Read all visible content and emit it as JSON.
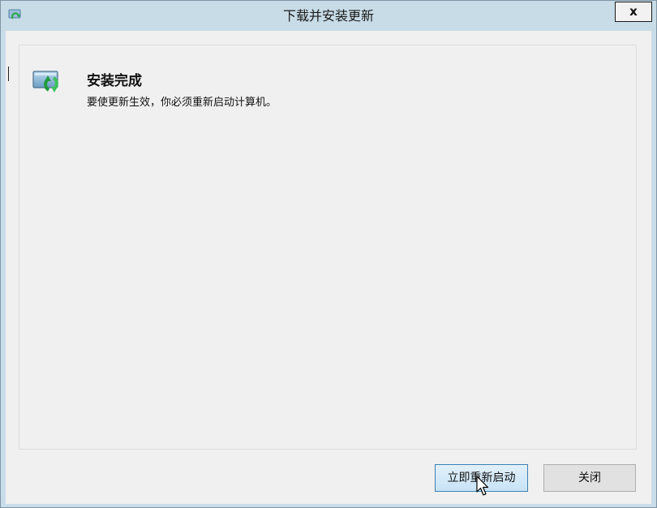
{
  "window": {
    "title": "下载并安装更新",
    "close_label": "x"
  },
  "status": {
    "heading": "安装完成",
    "message": "要使更新生效，你必须重新启动计算机。"
  },
  "buttons": {
    "restart_now": "立即重新启动",
    "close": "关闭"
  },
  "icons": {
    "app": "windows-update-icon",
    "status": "windows-update-icon",
    "pointer": "mouse-pointer-icon"
  },
  "colors": {
    "accent_border": "#3c7fb1",
    "update_green": "#2fa84f"
  }
}
